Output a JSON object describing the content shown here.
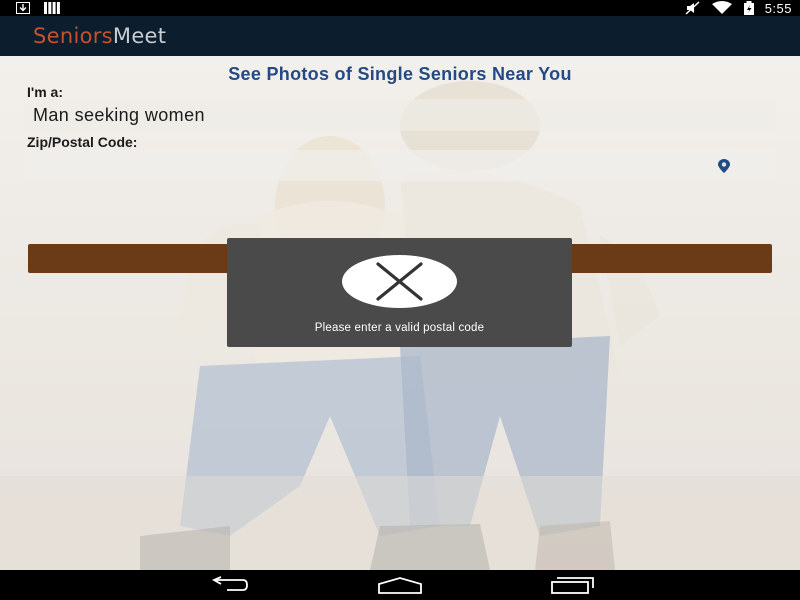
{
  "status_bar": {
    "time": "5:55",
    "left_icons": [
      "download-icon",
      "signal-bars-icon"
    ],
    "right_icons": [
      "mute-icon",
      "wifi-icon",
      "battery-icon"
    ]
  },
  "header": {
    "brand_part1": "Seniors",
    "brand_part2": "Meet",
    "brand_color_1": "#c4522c",
    "brand_color_2": "#c8cdd3",
    "background_color": "#0c1d2d"
  },
  "form": {
    "headline": "See Photos of Single Seniors Near You",
    "iam_label": "I'm a:",
    "iam_value": "Man seeking women",
    "zip_label": "Zip/Postal Code:",
    "zip_value": "",
    "location_icon": "location-pin-icon",
    "submit_color": "#6b3a17"
  },
  "toast": {
    "icon": "close-x-icon",
    "message": "Please enter a valid postal code"
  },
  "nav_bar": {
    "buttons": [
      "back-icon",
      "home-icon",
      "recents-icon"
    ]
  },
  "colors": {
    "headline": "#244a83",
    "toast_background": "#4a4a4a"
  }
}
